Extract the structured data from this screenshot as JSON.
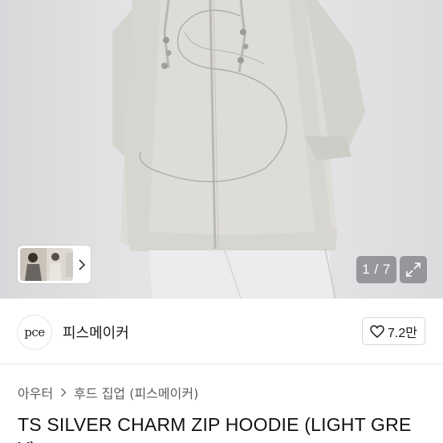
{
  "gallery": {
    "counter": "1 / 7",
    "thumb_arrow": "chevron-right-icon",
    "expand_icon": "expand-icon"
  },
  "shop": {
    "logo_text": "pce",
    "name": "피스메이커",
    "likes": "7.2만",
    "like_icon": "heart-icon"
  },
  "breadcrumb": {
    "items": [
      "아우터",
      "후드 집업 (피스메이커)"
    ]
  },
  "product": {
    "title_line1": "TS SILVER CHARM ZIP HOODIE (LIGHT GRE",
    "title_line2": "Y)"
  },
  "colors": {
    "hoodie": "#dcdbd6",
    "background": "#e4e4e6",
    "overlay": "#5a5a60"
  }
}
